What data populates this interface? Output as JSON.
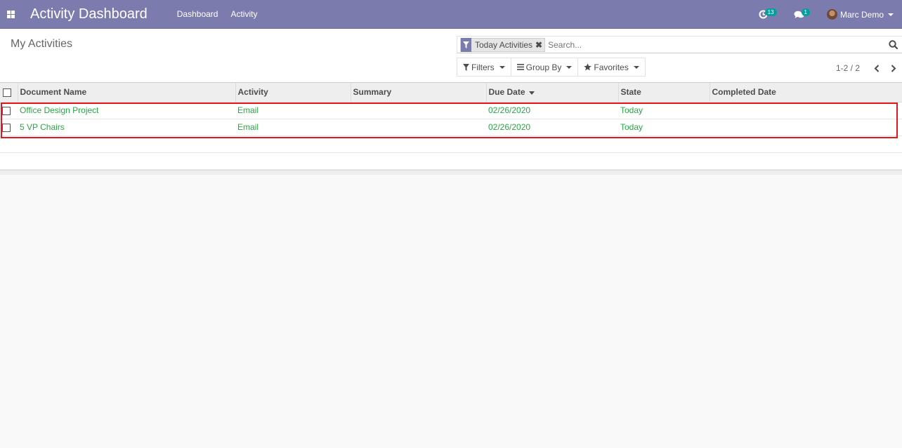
{
  "navbar": {
    "app_title": "Activity Dashboard",
    "menu": [
      "Dashboard",
      "Activity"
    ],
    "activity_badge": "13",
    "message_badge": "1",
    "user_name": "Marc Demo"
  },
  "control_panel": {
    "breadcrumb": "My Activities",
    "facet_label": "Today Activities",
    "facet_remove": "✖",
    "search_placeholder": "Search...",
    "filters_label": "Filters",
    "groupby_label": "Group By",
    "favorites_label": "Favorites",
    "pager_value": "1-2 / 2"
  },
  "list": {
    "columns": [
      "Document Name",
      "Activity",
      "Summary",
      "Due Date",
      "State",
      "Completed Date"
    ],
    "rows": [
      {
        "document": "Office Design Project",
        "activity": "Email",
        "summary": "",
        "due_date": "02/26/2020",
        "state": "Today",
        "completed": ""
      },
      {
        "document": "5 VP Chairs",
        "activity": "Email",
        "summary": "",
        "due_date": "02/26/2020",
        "state": "Today",
        "completed": ""
      }
    ]
  },
  "colors": {
    "navbar": "#7c7bad",
    "row_text": "#28a745",
    "highlight": "#e0191f",
    "badge": "#00a09d"
  }
}
